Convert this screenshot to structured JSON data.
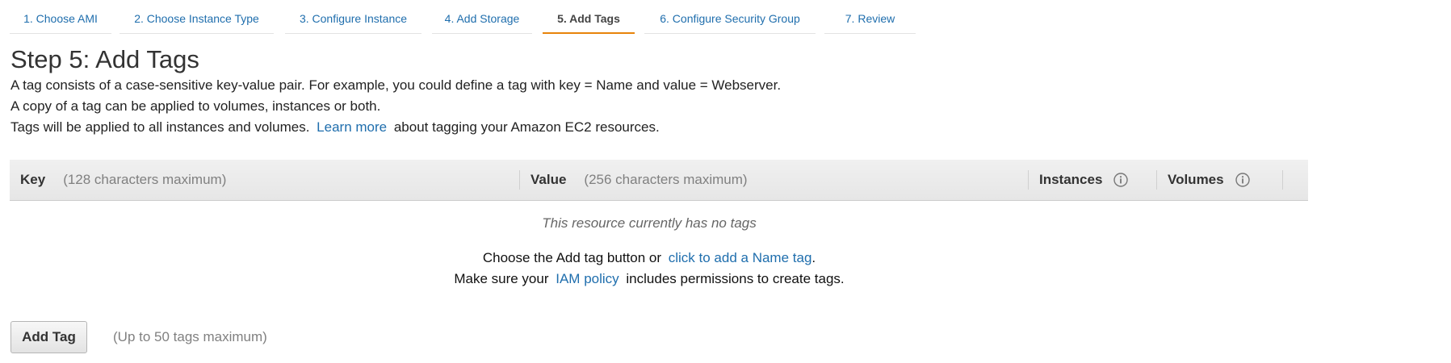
{
  "wizard": {
    "steps": [
      {
        "label": "1. Choose AMI"
      },
      {
        "label": "2. Choose Instance Type"
      },
      {
        "label": "3. Configure Instance"
      },
      {
        "label": "4. Add Storage"
      },
      {
        "label": "5. Add Tags",
        "active": true
      },
      {
        "label": "6. Configure Security Group"
      },
      {
        "label": "7. Review"
      }
    ]
  },
  "page": {
    "title": "Step 5: Add Tags",
    "line1": "A tag consists of a case-sensitive key-value pair. For example, you could define a tag with key = Name and value = Webserver.",
    "line2": "A copy of a tag can be applied to volumes, instances or both.",
    "line3_before": "Tags will be applied to all instances and volumes.",
    "line3_link": "Learn more",
    "line3_after": "about tagging your Amazon EC2 resources."
  },
  "table": {
    "key_header": "Key",
    "key_hint": "(128 characters maximum)",
    "value_header": "Value",
    "value_hint": "(256 characters maximum)",
    "instances_header": "Instances",
    "volumes_header": "Volumes",
    "empty_message": "This resource currently has no tags",
    "choose_before": "Choose the Add tag button or",
    "choose_link": "click to add a Name tag",
    "choose_after": ".",
    "iam_before": "Make sure your",
    "iam_link": "IAM policy",
    "iam_after": "includes permissions to create tags."
  },
  "actions": {
    "add_tag_label": "Add Tag",
    "add_tag_hint": "(Up to 50 tags maximum)"
  },
  "colors": {
    "link": "#1f6ead",
    "active_tab_underline": "#e7830a",
    "header_bg": "#e9e9e9"
  },
  "icons": {
    "info": "info-circle-icon"
  }
}
